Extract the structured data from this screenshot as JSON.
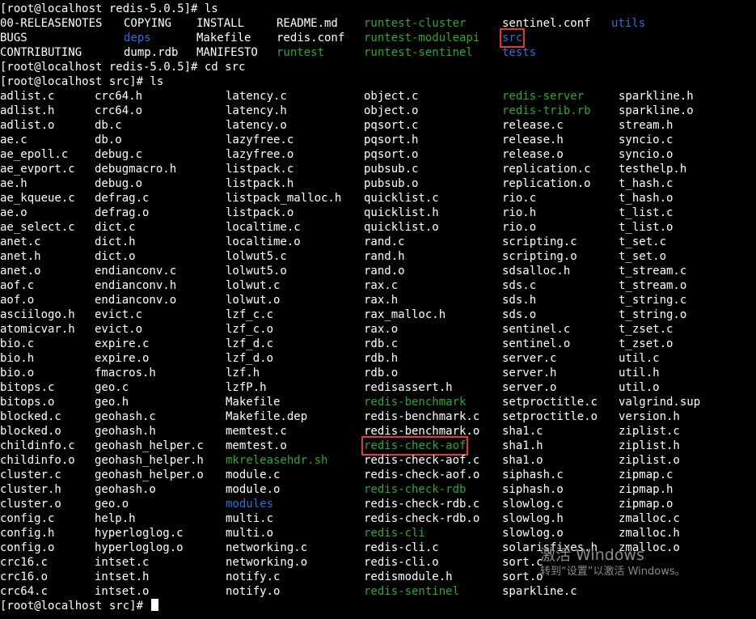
{
  "colors": {
    "background": "#000000",
    "file": "#ffffff",
    "executable": "#2ea82e",
    "directory": "#2f6fe0",
    "highlight_box": "#e8353a"
  },
  "session": {
    "commands": [
      "[root@localhost redis-5.0.5]# ls",
      "[root@localhost redis-5.0.5]# cd src",
      "[root@localhost src]# ls",
      "[root@localhost src]# "
    ],
    "top_listing": [
      [
        {
          "name": "00-RELEASENOTES",
          "type": "file"
        },
        {
          "name": "COPYING",
          "type": "file"
        },
        {
          "name": "INSTALL",
          "type": "file"
        },
        {
          "name": "README.md",
          "type": "file"
        },
        {
          "name": "runtest-cluster",
          "type": "exec"
        },
        {
          "name": "sentinel.conf",
          "type": "file"
        },
        {
          "name": "utils",
          "type": "dir"
        }
      ],
      [
        {
          "name": "BUGS",
          "type": "file"
        },
        {
          "name": "deps",
          "type": "dir"
        },
        {
          "name": "Makefile",
          "type": "file"
        },
        {
          "name": "redis.conf",
          "type": "file"
        },
        {
          "name": "runtest-moduleapi",
          "type": "exec"
        },
        {
          "name": "src",
          "type": "dir",
          "highlight": true
        },
        {
          "name": "",
          "type": "file"
        }
      ],
      [
        {
          "name": "CONTRIBUTING",
          "type": "file"
        },
        {
          "name": "dump.rdb",
          "type": "file"
        },
        {
          "name": "MANIFESTO",
          "type": "file"
        },
        {
          "name": "runtest",
          "type": "exec"
        },
        {
          "name": "runtest-sentinel",
          "type": "exec"
        },
        {
          "name": "tests",
          "type": "dir"
        },
        {
          "name": "",
          "type": "file"
        }
      ]
    ],
    "src_listing": [
      [
        {
          "name": "adlist.c",
          "type": "file"
        },
        {
          "name": "crc64.h",
          "type": "file"
        },
        {
          "name": "latency.c",
          "type": "file"
        },
        {
          "name": "object.c",
          "type": "file"
        },
        {
          "name": "redis-server",
          "type": "exec"
        },
        {
          "name": "sparkline.h",
          "type": "file"
        }
      ],
      [
        {
          "name": "adlist.h",
          "type": "file"
        },
        {
          "name": "crc64.o",
          "type": "file"
        },
        {
          "name": "latency.h",
          "type": "file"
        },
        {
          "name": "object.o",
          "type": "file"
        },
        {
          "name": "redis-trib.rb",
          "type": "exec"
        },
        {
          "name": "sparkline.o",
          "type": "file"
        }
      ],
      [
        {
          "name": "adlist.o",
          "type": "file"
        },
        {
          "name": "db.c",
          "type": "file"
        },
        {
          "name": "latency.o",
          "type": "file"
        },
        {
          "name": "pqsort.c",
          "type": "file"
        },
        {
          "name": "release.c",
          "type": "file"
        },
        {
          "name": "stream.h",
          "type": "file"
        }
      ],
      [
        {
          "name": "ae.c",
          "type": "file"
        },
        {
          "name": "db.o",
          "type": "file"
        },
        {
          "name": "lazyfree.c",
          "type": "file"
        },
        {
          "name": "pqsort.h",
          "type": "file"
        },
        {
          "name": "release.h",
          "type": "file"
        },
        {
          "name": "syncio.c",
          "type": "file"
        }
      ],
      [
        {
          "name": "ae_epoll.c",
          "type": "file"
        },
        {
          "name": "debug.c",
          "type": "file"
        },
        {
          "name": "lazyfree.o",
          "type": "file"
        },
        {
          "name": "pqsort.o",
          "type": "file"
        },
        {
          "name": "release.o",
          "type": "file"
        },
        {
          "name": "syncio.o",
          "type": "file"
        }
      ],
      [
        {
          "name": "ae_evport.c",
          "type": "file"
        },
        {
          "name": "debugmacro.h",
          "type": "file"
        },
        {
          "name": "listpack.c",
          "type": "file"
        },
        {
          "name": "pubsub.c",
          "type": "file"
        },
        {
          "name": "replication.c",
          "type": "file"
        },
        {
          "name": "testhelp.h",
          "type": "file"
        }
      ],
      [
        {
          "name": "ae.h",
          "type": "file"
        },
        {
          "name": "debug.o",
          "type": "file"
        },
        {
          "name": "listpack.h",
          "type": "file"
        },
        {
          "name": "pubsub.o",
          "type": "file"
        },
        {
          "name": "replication.o",
          "type": "file"
        },
        {
          "name": "t_hash.c",
          "type": "file"
        }
      ],
      [
        {
          "name": "ae_kqueue.c",
          "type": "file"
        },
        {
          "name": "defrag.c",
          "type": "file"
        },
        {
          "name": "listpack_malloc.h",
          "type": "file"
        },
        {
          "name": "quicklist.c",
          "type": "file"
        },
        {
          "name": "rio.c",
          "type": "file"
        },
        {
          "name": "t_hash.o",
          "type": "file"
        }
      ],
      [
        {
          "name": "ae.o",
          "type": "file"
        },
        {
          "name": "defrag.o",
          "type": "file"
        },
        {
          "name": "listpack.o",
          "type": "file"
        },
        {
          "name": "quicklist.h",
          "type": "file"
        },
        {
          "name": "rio.h",
          "type": "file"
        },
        {
          "name": "t_list.c",
          "type": "file"
        }
      ],
      [
        {
          "name": "ae_select.c",
          "type": "file"
        },
        {
          "name": "dict.c",
          "type": "file"
        },
        {
          "name": "localtime.c",
          "type": "file"
        },
        {
          "name": "quicklist.o",
          "type": "file"
        },
        {
          "name": "rio.o",
          "type": "file"
        },
        {
          "name": "t_list.o",
          "type": "file"
        }
      ],
      [
        {
          "name": "anet.c",
          "type": "file"
        },
        {
          "name": "dict.h",
          "type": "file"
        },
        {
          "name": "localtime.o",
          "type": "file"
        },
        {
          "name": "rand.c",
          "type": "file"
        },
        {
          "name": "scripting.c",
          "type": "file"
        },
        {
          "name": "t_set.c",
          "type": "file"
        }
      ],
      [
        {
          "name": "anet.h",
          "type": "file"
        },
        {
          "name": "dict.o",
          "type": "file"
        },
        {
          "name": "lolwut5.c",
          "type": "file"
        },
        {
          "name": "rand.h",
          "type": "file"
        },
        {
          "name": "scripting.o",
          "type": "file"
        },
        {
          "name": "t_set.o",
          "type": "file"
        }
      ],
      [
        {
          "name": "anet.o",
          "type": "file"
        },
        {
          "name": "endianconv.c",
          "type": "file"
        },
        {
          "name": "lolwut5.o",
          "type": "file"
        },
        {
          "name": "rand.o",
          "type": "file"
        },
        {
          "name": "sdsalloc.h",
          "type": "file"
        },
        {
          "name": "t_stream.c",
          "type": "file"
        }
      ],
      [
        {
          "name": "aof.c",
          "type": "file"
        },
        {
          "name": "endianconv.h",
          "type": "file"
        },
        {
          "name": "lolwut.c",
          "type": "file"
        },
        {
          "name": "rax.c",
          "type": "file"
        },
        {
          "name": "sds.c",
          "type": "file"
        },
        {
          "name": "t_stream.o",
          "type": "file"
        }
      ],
      [
        {
          "name": "aof.o",
          "type": "file"
        },
        {
          "name": "endianconv.o",
          "type": "file"
        },
        {
          "name": "lolwut.o",
          "type": "file"
        },
        {
          "name": "rax.h",
          "type": "file"
        },
        {
          "name": "sds.h",
          "type": "file"
        },
        {
          "name": "t_string.c",
          "type": "file"
        }
      ],
      [
        {
          "name": "asciilogo.h",
          "type": "file"
        },
        {
          "name": "evict.c",
          "type": "file"
        },
        {
          "name": "lzf_c.c",
          "type": "file"
        },
        {
          "name": "rax_malloc.h",
          "type": "file"
        },
        {
          "name": "sds.o",
          "type": "file"
        },
        {
          "name": "t_string.o",
          "type": "file"
        }
      ],
      [
        {
          "name": "atomicvar.h",
          "type": "file"
        },
        {
          "name": "evict.o",
          "type": "file"
        },
        {
          "name": "lzf_c.o",
          "type": "file"
        },
        {
          "name": "rax.o",
          "type": "file"
        },
        {
          "name": "sentinel.c",
          "type": "file"
        },
        {
          "name": "t_zset.c",
          "type": "file"
        }
      ],
      [
        {
          "name": "bio.c",
          "type": "file"
        },
        {
          "name": "expire.c",
          "type": "file"
        },
        {
          "name": "lzf_d.c",
          "type": "file"
        },
        {
          "name": "rdb.c",
          "type": "file"
        },
        {
          "name": "sentinel.o",
          "type": "file"
        },
        {
          "name": "t_zset.o",
          "type": "file"
        }
      ],
      [
        {
          "name": "bio.h",
          "type": "file"
        },
        {
          "name": "expire.o",
          "type": "file"
        },
        {
          "name": "lzf_d.o",
          "type": "file"
        },
        {
          "name": "rdb.h",
          "type": "file"
        },
        {
          "name": "server.c",
          "type": "file"
        },
        {
          "name": "util.c",
          "type": "file"
        }
      ],
      [
        {
          "name": "bio.o",
          "type": "file"
        },
        {
          "name": "fmacros.h",
          "type": "file"
        },
        {
          "name": "lzf.h",
          "type": "file"
        },
        {
          "name": "rdb.o",
          "type": "file"
        },
        {
          "name": "server.h",
          "type": "file"
        },
        {
          "name": "util.h",
          "type": "file"
        }
      ],
      [
        {
          "name": "bitops.c",
          "type": "file"
        },
        {
          "name": "geo.c",
          "type": "file"
        },
        {
          "name": "lzfP.h",
          "type": "file"
        },
        {
          "name": "redisassert.h",
          "type": "file"
        },
        {
          "name": "server.o",
          "type": "file"
        },
        {
          "name": "util.o",
          "type": "file"
        }
      ],
      [
        {
          "name": "bitops.o",
          "type": "file"
        },
        {
          "name": "geo.h",
          "type": "file"
        },
        {
          "name": "Makefile",
          "type": "file"
        },
        {
          "name": "redis-benchmark",
          "type": "exec"
        },
        {
          "name": "setproctitle.c",
          "type": "file"
        },
        {
          "name": "valgrind.sup",
          "type": "file"
        }
      ],
      [
        {
          "name": "blocked.c",
          "type": "file"
        },
        {
          "name": "geohash.c",
          "type": "file"
        },
        {
          "name": "Makefile.dep",
          "type": "file"
        },
        {
          "name": "redis-benchmark.c",
          "type": "file"
        },
        {
          "name": "setproctitle.o",
          "type": "file"
        },
        {
          "name": "version.h",
          "type": "file"
        }
      ],
      [
        {
          "name": "blocked.o",
          "type": "file"
        },
        {
          "name": "geohash.h",
          "type": "file"
        },
        {
          "name": "memtest.c",
          "type": "file"
        },
        {
          "name": "redis-benchmark.o",
          "type": "file"
        },
        {
          "name": "sha1.c",
          "type": "file"
        },
        {
          "name": "ziplist.c",
          "type": "file"
        }
      ],
      [
        {
          "name": "childinfo.c",
          "type": "file"
        },
        {
          "name": "geohash_helper.c",
          "type": "file"
        },
        {
          "name": "memtest.o",
          "type": "file"
        },
        {
          "name": "redis-check-aof",
          "type": "exec",
          "highlight": true
        },
        {
          "name": "sha1.h",
          "type": "file"
        },
        {
          "name": "ziplist.h",
          "type": "file"
        }
      ],
      [
        {
          "name": "childinfo.o",
          "type": "file"
        },
        {
          "name": "geohash_helper.h",
          "type": "file"
        },
        {
          "name": "mkreleasehdr.sh",
          "type": "exec"
        },
        {
          "name": "redis-check-aof.c",
          "type": "file"
        },
        {
          "name": "sha1.o",
          "type": "file"
        },
        {
          "name": "ziplist.o",
          "type": "file"
        }
      ],
      [
        {
          "name": "cluster.c",
          "type": "file"
        },
        {
          "name": "geohash_helper.o",
          "type": "file"
        },
        {
          "name": "module.c",
          "type": "file"
        },
        {
          "name": "redis-check-aof.o",
          "type": "file"
        },
        {
          "name": "siphash.c",
          "type": "file"
        },
        {
          "name": "zipmap.c",
          "type": "file"
        }
      ],
      [
        {
          "name": "cluster.h",
          "type": "file"
        },
        {
          "name": "geohash.o",
          "type": "file"
        },
        {
          "name": "module.o",
          "type": "file"
        },
        {
          "name": "redis-check-rdb",
          "type": "exec"
        },
        {
          "name": "siphash.o",
          "type": "file"
        },
        {
          "name": "zipmap.h",
          "type": "file"
        }
      ],
      [
        {
          "name": "cluster.o",
          "type": "file"
        },
        {
          "name": "geo.o",
          "type": "file"
        },
        {
          "name": "modules",
          "type": "dir"
        },
        {
          "name": "redis-check-rdb.c",
          "type": "file"
        },
        {
          "name": "slowlog.c",
          "type": "file"
        },
        {
          "name": "zipmap.o",
          "type": "file"
        }
      ],
      [
        {
          "name": "config.c",
          "type": "file"
        },
        {
          "name": "help.h",
          "type": "file"
        },
        {
          "name": "multi.c",
          "type": "file"
        },
        {
          "name": "redis-check-rdb.o",
          "type": "file"
        },
        {
          "name": "slowlog.h",
          "type": "file"
        },
        {
          "name": "zmalloc.c",
          "type": "file"
        }
      ],
      [
        {
          "name": "config.h",
          "type": "file"
        },
        {
          "name": "hyperloglog.c",
          "type": "file"
        },
        {
          "name": "multi.o",
          "type": "file"
        },
        {
          "name": "redis-cli",
          "type": "exec"
        },
        {
          "name": "slowlog.o",
          "type": "file"
        },
        {
          "name": "zmalloc.h",
          "type": "file"
        }
      ],
      [
        {
          "name": "config.o",
          "type": "file"
        },
        {
          "name": "hyperloglog.o",
          "type": "file"
        },
        {
          "name": "networking.c",
          "type": "file"
        },
        {
          "name": "redis-cli.c",
          "type": "file"
        },
        {
          "name": "solarisfixes.h",
          "type": "file"
        },
        {
          "name": "zmalloc.o",
          "type": "file"
        }
      ],
      [
        {
          "name": "crc16.c",
          "type": "file"
        },
        {
          "name": "intset.c",
          "type": "file"
        },
        {
          "name": "networking.o",
          "type": "file"
        },
        {
          "name": "redis-cli.o",
          "type": "file"
        },
        {
          "name": "sort.c",
          "type": "file"
        },
        {
          "name": "",
          "type": "file"
        }
      ],
      [
        {
          "name": "crc16.o",
          "type": "file"
        },
        {
          "name": "intset.h",
          "type": "file"
        },
        {
          "name": "notify.c",
          "type": "file"
        },
        {
          "name": "redismodule.h",
          "type": "file"
        },
        {
          "name": "sort.o",
          "type": "file"
        },
        {
          "name": "",
          "type": "file"
        }
      ],
      [
        {
          "name": "crc64.c",
          "type": "file"
        },
        {
          "name": "intset.o",
          "type": "file"
        },
        {
          "name": "notify.o",
          "type": "file"
        },
        {
          "name": "redis-sentinel",
          "type": "exec"
        },
        {
          "name": "sparkline.c",
          "type": "file"
        },
        {
          "name": "",
          "type": "file"
        }
      ]
    ]
  },
  "watermark": {
    "title": "激活 Windows",
    "subtitle": "转到“设置”以激活 Windows。"
  }
}
